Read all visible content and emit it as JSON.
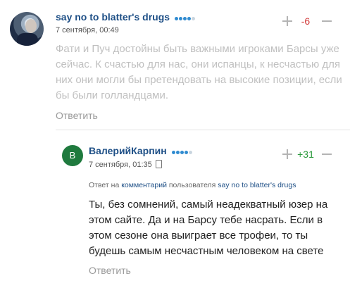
{
  "comments": [
    {
      "username": "say no to blatter's drugs",
      "date": "7 сентября, 00:49",
      "score": "-6",
      "rating_dots": {
        "on": 4,
        "off": 1
      },
      "text": "Фати и Пуч достойны быть важными игроками Барсы уже сейчас. К счастью для нас, они испанцы, к несчастью для них они могли бы претендовать на высокие позиции, если бы были голландцами.",
      "reply_label": "Ответить"
    },
    {
      "username": "ВалерийКарпин",
      "avatar_letter": "B",
      "date": "7 сентября, 01:35",
      "score": "+31",
      "rating_dots": {
        "on": 4,
        "off": 1
      },
      "reply_to": {
        "prefix": "Ответ на",
        "link": "комментарий",
        "middle": "пользователя",
        "user": "say no to blatter's drugs"
      },
      "text": "Ты, без сомнений, самый неадекватный юзер на этом сайте. Да и на Барсу тебе насрать. Если в этом сезоне она выиграет все трофеи, то ты будешь самым несчастным человеком на свете",
      "reply_label": "Ответить"
    }
  ],
  "colors": {
    "username": "#1e4f86",
    "negative_score": "#d23a3a",
    "positive_score": "#2b9a3c",
    "avatar_bg": "#1f7a3e"
  }
}
